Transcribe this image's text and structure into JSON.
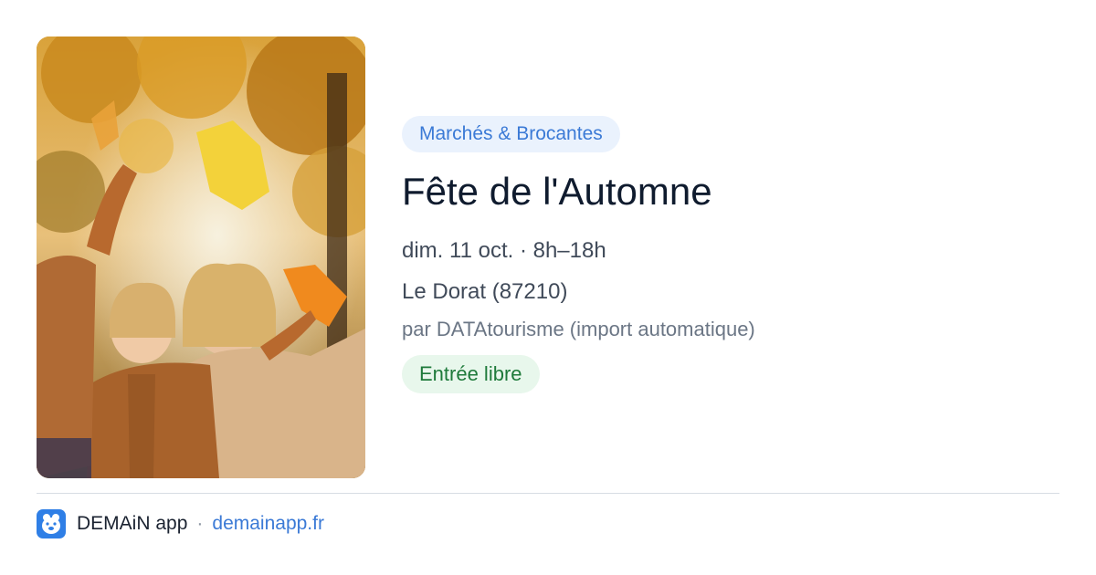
{
  "event": {
    "category": "Marchés & Brocantes",
    "title": "Fête de l'Automne",
    "datetime": "dim. 11 oct. · 8h–18h",
    "location": "Le Dorat (87210)",
    "source": "par DATAtourisme (import automatique)",
    "price": "Entrée libre",
    "image_icon": "autumn-family-photo"
  },
  "footer": {
    "app_icon": "demain-app-icon",
    "app_name": "DEMAiN app",
    "separator": "·",
    "link": "demainapp.fr"
  },
  "colors": {
    "category_bg": "#eaf2fd",
    "category_text": "#3b7ad6",
    "price_bg": "#e8f7ec",
    "price_text": "#1e7a3a",
    "title": "#0f1b2e",
    "link": "#3b7ad6",
    "app_icon_bg": "#2f7fe6"
  }
}
